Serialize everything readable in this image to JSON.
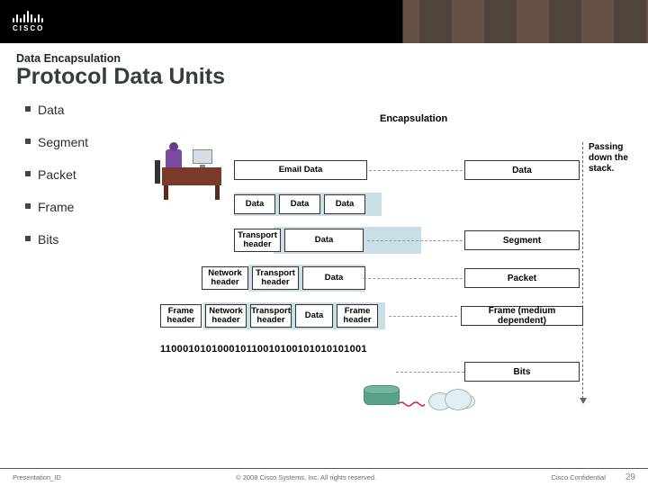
{
  "logo_word": "CISCO",
  "pretitle": "Data Encapsulation",
  "title": "Protocol Data Units",
  "bullets": [
    "Data",
    "Segment",
    "Packet",
    "Frame",
    "Bits"
  ],
  "diagram": {
    "title": "Encapsulation",
    "side_label_1": "Passing",
    "side_label_2": "down the",
    "side_label_3": "stack.",
    "row1": {
      "box": "Email Data",
      "label": "Data"
    },
    "row2": {
      "b1": "Data",
      "b2": "Data",
      "b3": "Data"
    },
    "row3": {
      "hdr": "Transport header",
      "data": "Data",
      "label": "Segment"
    },
    "row4": {
      "hdr1": "Network header",
      "hdr2": "Transport header",
      "data": "Data",
      "label": "Packet"
    },
    "row5": {
      "hdr1": "Frame header",
      "hdr2": "Network header",
      "hdr3": "Transport header",
      "data": "Data",
      "trl": "Frame header",
      "label": "Frame (medium dependent)"
    },
    "bits": "110001010100010110010100101010101001",
    "bits_label": "Bits"
  },
  "footer": {
    "pid": "Presentation_ID",
    "copyright": "© 2008 Cisco Systems, Inc. All rights reserved.",
    "confidential": "Cisco Confidential",
    "page": "29"
  }
}
